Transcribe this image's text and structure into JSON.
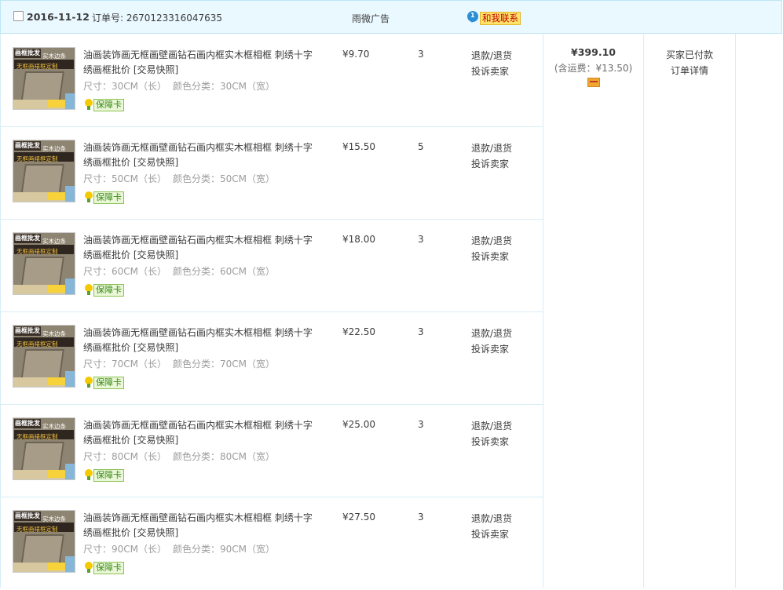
{
  "header": {
    "date": "2016-11-12",
    "order_label": "订单号: 2670123316047635",
    "shop_name": "雨微广告",
    "contact_label": "和我联系",
    "contact_badge": "1"
  },
  "thumb_text": {
    "top_left": "画框批发",
    "top_right": "实木边条",
    "band": "无框画裱框定制"
  },
  "items": [
    {
      "title": "油画装饰画无框画壁画钻石画内框实木框相框 刺绣十字绣画框批价 [交易快照]",
      "size": "尺寸：30CM（长）",
      "color": "颜色分类：30CM（宽）",
      "guarantee": "保障卡",
      "price": "¥9.70",
      "qty": "3",
      "action1": "退款/退货",
      "action2": "投诉卖家"
    },
    {
      "title": "油画装饰画无框画壁画钻石画内框实木框相框 刺绣十字绣画框批价 [交易快照]",
      "size": "尺寸：50CM（长）",
      "color": "颜色分类：50CM（宽）",
      "guarantee": "保障卡",
      "price": "¥15.50",
      "qty": "5",
      "action1": "退款/退货",
      "action2": "投诉卖家"
    },
    {
      "title": "油画装饰画无框画壁画钻石画内框实木框相框 刺绣十字绣画框批价 [交易快照]",
      "size": "尺寸：60CM（长）",
      "color": "颜色分类：60CM（宽）",
      "guarantee": "保障卡",
      "price": "¥18.00",
      "qty": "3",
      "action1": "退款/退货",
      "action2": "投诉卖家"
    },
    {
      "title": "油画装饰画无框画壁画钻石画内框实木框相框 刺绣十字绣画框批价 [交易快照]",
      "size": "尺寸：70CM（长）",
      "color": "颜色分类：70CM（宽）",
      "guarantee": "保障卡",
      "price": "¥22.50",
      "qty": "3",
      "action1": "退款/退货",
      "action2": "投诉卖家"
    },
    {
      "title": "油画装饰画无框画壁画钻石画内框实木框相框 刺绣十字绣画框批价 [交易快照]",
      "size": "尺寸：80CM（长）",
      "color": "颜色分类：80CM（宽）",
      "guarantee": "保障卡",
      "price": "¥25.00",
      "qty": "3",
      "action1": "退款/退货",
      "action2": "投诉卖家"
    },
    {
      "title": "油画装饰画无框画壁画钻石画内框实木框相框 刺绣十字绣画框批价 [交易快照]",
      "size": "尺寸：90CM（长）",
      "color": "颜色分类：90CM（宽）",
      "guarantee": "保障卡",
      "price": "¥27.50",
      "qty": "3",
      "action1": "退款/退货",
      "action2": "投诉卖家"
    }
  ],
  "summary": {
    "total": "¥399.10",
    "shipping": "(含运费：¥13.50)",
    "status": "买家已付款",
    "details_link": "订单详情"
  }
}
